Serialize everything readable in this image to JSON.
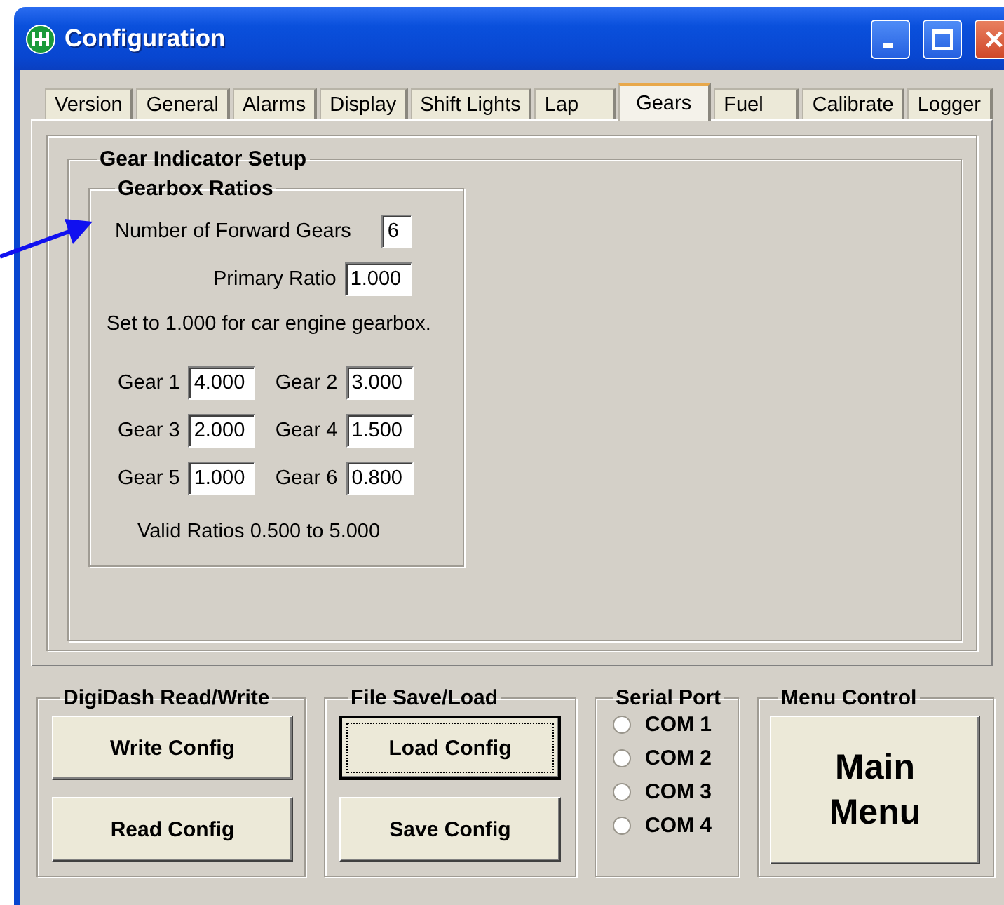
{
  "window": {
    "title": "Configuration"
  },
  "tabs": [
    {
      "label": "Version",
      "selected": false
    },
    {
      "label": "General",
      "selected": false
    },
    {
      "label": "Alarms",
      "selected": false
    },
    {
      "label": "Display",
      "selected": false
    },
    {
      "label": "Shift Lights",
      "selected": false
    },
    {
      "label": "Lap",
      "selected": false
    },
    {
      "label": "Gears",
      "selected": true
    },
    {
      "label": "Fuel",
      "selected": false
    },
    {
      "label": "Calibrate",
      "selected": false
    },
    {
      "label": "Logger",
      "selected": false
    }
  ],
  "gear_indicator_setup": {
    "title": "Gear Indicator Setup",
    "gearbox_ratios": {
      "title": "Gearbox Ratios",
      "forward_gears": {
        "label": "Number of Forward Gears",
        "value": "6"
      },
      "primary_ratio": {
        "label": "Primary Ratio",
        "value": "1.000"
      },
      "note": "Set to 1.000 for car engine gearbox.",
      "gears": [
        {
          "label": "Gear 1",
          "value": "4.000"
        },
        {
          "label": "Gear 2",
          "value": "3.000"
        },
        {
          "label": "Gear 3",
          "value": "2.000"
        },
        {
          "label": "Gear 4",
          "value": "1.500"
        },
        {
          "label": "Gear 5",
          "value": "1.000"
        },
        {
          "label": "Gear 6",
          "value": "0.800"
        }
      ],
      "valid_range": "Valid Ratios 0.500 to 5.000"
    }
  },
  "groups": {
    "read_write": {
      "title": "DigiDash Read/Write",
      "buttons": [
        {
          "label": "Write Config",
          "focused": false
        },
        {
          "label": "Read Config",
          "focused": false
        }
      ]
    },
    "file": {
      "title": "File Save/Load",
      "buttons": [
        {
          "label": "Load Config",
          "focused": true
        },
        {
          "label": "Save Config",
          "focused": false
        }
      ]
    },
    "serial_port": {
      "title": "Serial Port",
      "ports": [
        {
          "label": "COM 1",
          "selected": false
        },
        {
          "label": "COM 2",
          "selected": false
        },
        {
          "label": "COM 3",
          "selected": false
        },
        {
          "label": "COM 4",
          "selected": false
        }
      ]
    },
    "menu_control": {
      "title": "Menu Control",
      "button": "Main Menu"
    }
  }
}
